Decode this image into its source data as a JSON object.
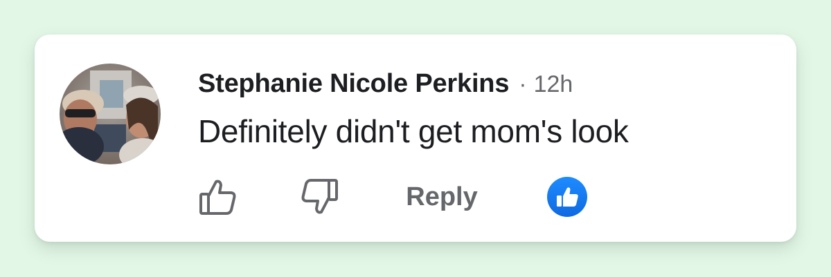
{
  "comment": {
    "author": "Stephanie Nicole Perkins",
    "separator": "·",
    "time": "12h",
    "text": "Definitely didn't get mom's look"
  },
  "actions": {
    "reply_label": "Reply",
    "like_icon": "thumbs-up-outline-icon",
    "dislike_icon": "thumbs-down-outline-icon",
    "reaction_icon": "like-reaction-icon"
  },
  "colors": {
    "background": "#e3f7e6",
    "card": "#ffffff",
    "text": "#1c1e21",
    "muted": "#65676b",
    "reaction_blue": "#1877f2"
  }
}
